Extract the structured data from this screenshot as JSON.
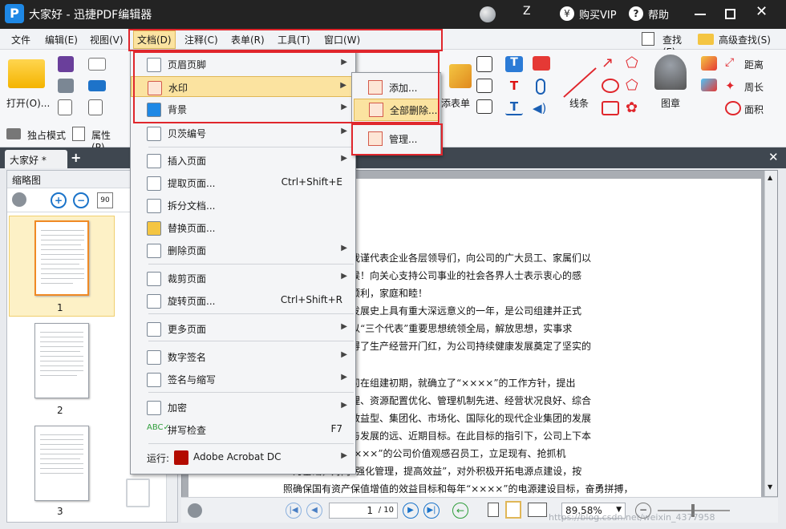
{
  "titlebar": {
    "app_title": "大家好 - 迅捷PDF编辑器",
    "user": "Z",
    "vip": "购买VIP",
    "help": "帮助"
  },
  "menubar": [
    "文件",
    "编辑(E)",
    "视图(V)",
    "文档(D)",
    "注释(C)",
    "表单(R)",
    "工具(T)",
    "窗口(W)"
  ],
  "search": {
    "find": "查找(F)",
    "advanced_find": "高级查找(S)"
  },
  "ribbon": {
    "open": "打开(O)...",
    "exclusive": "独占模式",
    "properties": "属性(P)...",
    "sign_form": "添表单",
    "line": "线条",
    "stamp": "图章",
    "distance": "距离",
    "perimeter": "周长",
    "area": "面积"
  },
  "tab": {
    "name": "大家好 *"
  },
  "sidebar": {
    "title": "缩略图",
    "pages": [
      "1",
      "2",
      "3"
    ]
  },
  "doc_menu": {
    "items": [
      {
        "label": "页眉页脚",
        "shortcut": "",
        "submenu": true
      },
      {
        "label": "水印",
        "shortcut": "",
        "submenu": true
      },
      {
        "label": "背景",
        "shortcut": "",
        "submenu": true
      },
      {
        "label": "贝茨编号",
        "shortcut": "",
        "submenu": true
      },
      {
        "label": "插入页面",
        "shortcut": "",
        "submenu": true
      },
      {
        "label": "提取页面...",
        "shortcut": "Ctrl+Shift+E",
        "submenu": false
      },
      {
        "label": "拆分文档...",
        "shortcut": "",
        "submenu": false
      },
      {
        "label": "替换页面...",
        "shortcut": "",
        "submenu": false
      },
      {
        "label": "删除页面",
        "shortcut": "",
        "submenu": true
      },
      {
        "label": "裁剪页面",
        "shortcut": "",
        "submenu": true
      },
      {
        "label": "旋转页面...",
        "shortcut": "Ctrl+Shift+R",
        "submenu": false
      },
      {
        "label": "更多页面",
        "shortcut": "",
        "submenu": true
      },
      {
        "label": "数字签名",
        "shortcut": "",
        "submenu": true
      },
      {
        "label": "签名与缩写",
        "shortcut": "",
        "submenu": true
      },
      {
        "label": "加密",
        "shortcut": "",
        "submenu": true
      },
      {
        "label": "拼写检查",
        "shortcut": "F7",
        "submenu": false
      },
      {
        "label": "运行:",
        "shortcut": "",
        "submenu": true,
        "app": "Adobe Acrobat DC"
      }
    ]
  },
  "watermark_menu": {
    "items": [
      "添加...",
      "全部删除...",
      "管理..."
    ]
  },
  "document_text": [
    "旧迎新之际，我谨代表企业各层领导们，向公司的广大员工、家属们以",
    "致以节日的问候！向关心支持公司事业的社会各界人士表示衷心的感",
    "年快乐，工作顺利，家庭和睦！",
    "中国电力工业发展史上具有重大深远意义的一年，是公司组建并正式",
    "一年来，公司以“三个代表”重要思想统领全局，解放思想，实事求",
    "开拓进取，取得了生产经营开门红，为公司持续健康发展奠定了坚实的",
    "",
    "第一要务。公司在组建初期，就确立了“××××”的工作方针，提出",
    "为要素组合合理、资源配置优化、管理机制先进、经营状况良好、综合",
    "控股型、规模效益型、集团化、市场化、国际化的现代企业集团的发展",
    "确了公司改革与发展的远、近期目标。在此目标的指引下，公司上下本",
    "的理念，以“××××”的公司价值观感召员工，立足现有、抢抓机",
    "为基础，对内“强化管理，提高效益”，对外积极开拓电源点建设，按",
    "照确保国有资产保值增值的效益目标和每年“××××”的电源建设目标，奋勇拼搏，"
  ],
  "status": {
    "page_input": "1",
    "page_total": "/ 10",
    "zoom": "89.58%",
    "watermark": "https://blog.csdn.net/weixin_4377958"
  }
}
